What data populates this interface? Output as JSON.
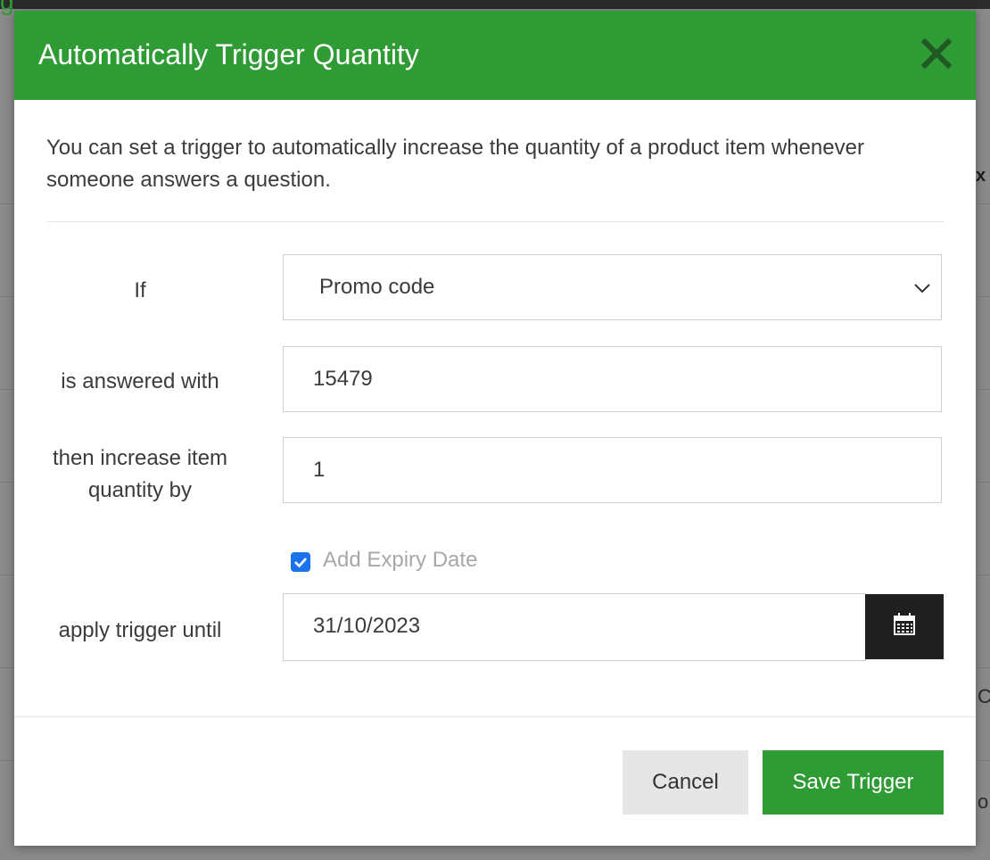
{
  "background": {
    "logo_glyph": "g",
    "right_letter_1": "x",
    "right_letter_2": "C",
    "right_letter_3": "o"
  },
  "modal": {
    "title": "Automatically Trigger Quantity",
    "close_icon": "close-x-icon",
    "description": "You can set a trigger to automatically increase the quantity of a product item whenever someone answers a question.",
    "form": {
      "if_label": "If",
      "question_select_value": "Promo code",
      "answered_label": "is answered with",
      "answer_value": "15479",
      "increase_label": "then increase item quantity by",
      "increase_value": "1",
      "expiry_checkbox_label": "Add Expiry Date",
      "expiry_checked": true,
      "until_label": "apply trigger until",
      "until_date": "31/10/2023",
      "calendar_icon": "calendar-icon"
    },
    "buttons": {
      "cancel": "Cancel",
      "save": "Save Trigger"
    }
  },
  "colors": {
    "header_green": "#2f9b35",
    "save_green": "#2f9b35",
    "calendar_button": "#1f1f1f",
    "checkbox_blue": "#1a73e8",
    "close_icon": "#1f5a24"
  }
}
